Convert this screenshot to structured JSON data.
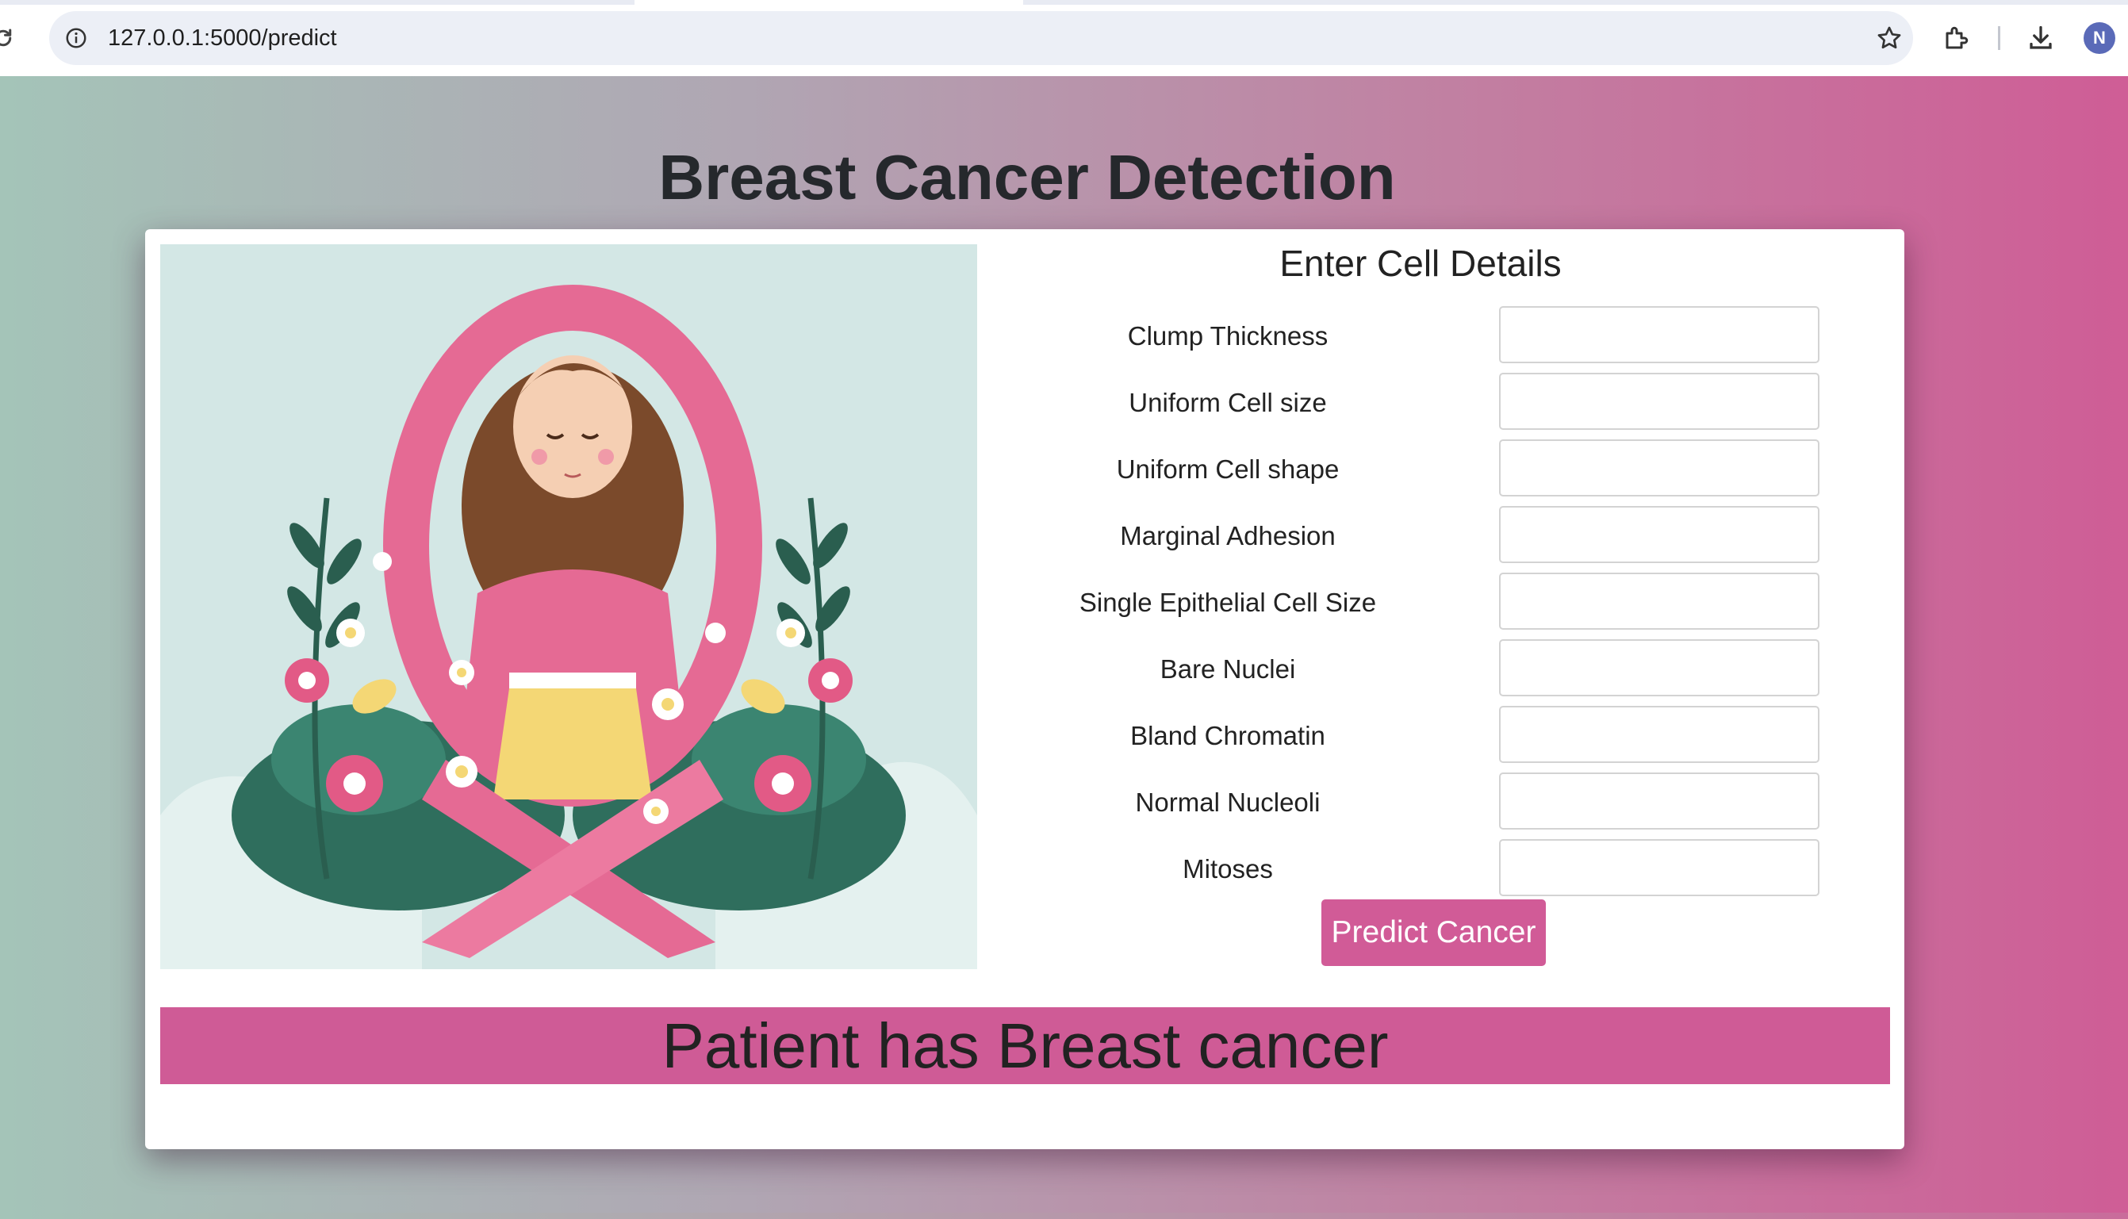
{
  "browser": {
    "url": "127.0.0.1:5000/predict",
    "profile_initial": "N"
  },
  "page": {
    "title": "Breast Cancer Detection"
  },
  "form": {
    "title": "Enter Cell Details",
    "fields": [
      {
        "label": "Clump Thickness",
        "value": ""
      },
      {
        "label": "Uniform Cell size",
        "value": ""
      },
      {
        "label": "Uniform Cell shape",
        "value": ""
      },
      {
        "label": "Marginal Adhesion",
        "value": ""
      },
      {
        "label": "Single Epithelial Cell Size",
        "value": ""
      },
      {
        "label": "Bare Nuclei",
        "value": ""
      },
      {
        "label": "Bland Chromatin",
        "value": ""
      },
      {
        "label": "Normal Nucleoli",
        "value": ""
      },
      {
        "label": "Mitoses",
        "value": ""
      }
    ],
    "submit_label": "Predict Cancer"
  },
  "result": {
    "text": "Patient has Breast cancer"
  },
  "colors": {
    "accent": "#cf5b96",
    "title": "#25282c"
  },
  "icons": [
    "reload-icon",
    "info-icon",
    "star-icon",
    "extensions-icon",
    "download-icon"
  ]
}
